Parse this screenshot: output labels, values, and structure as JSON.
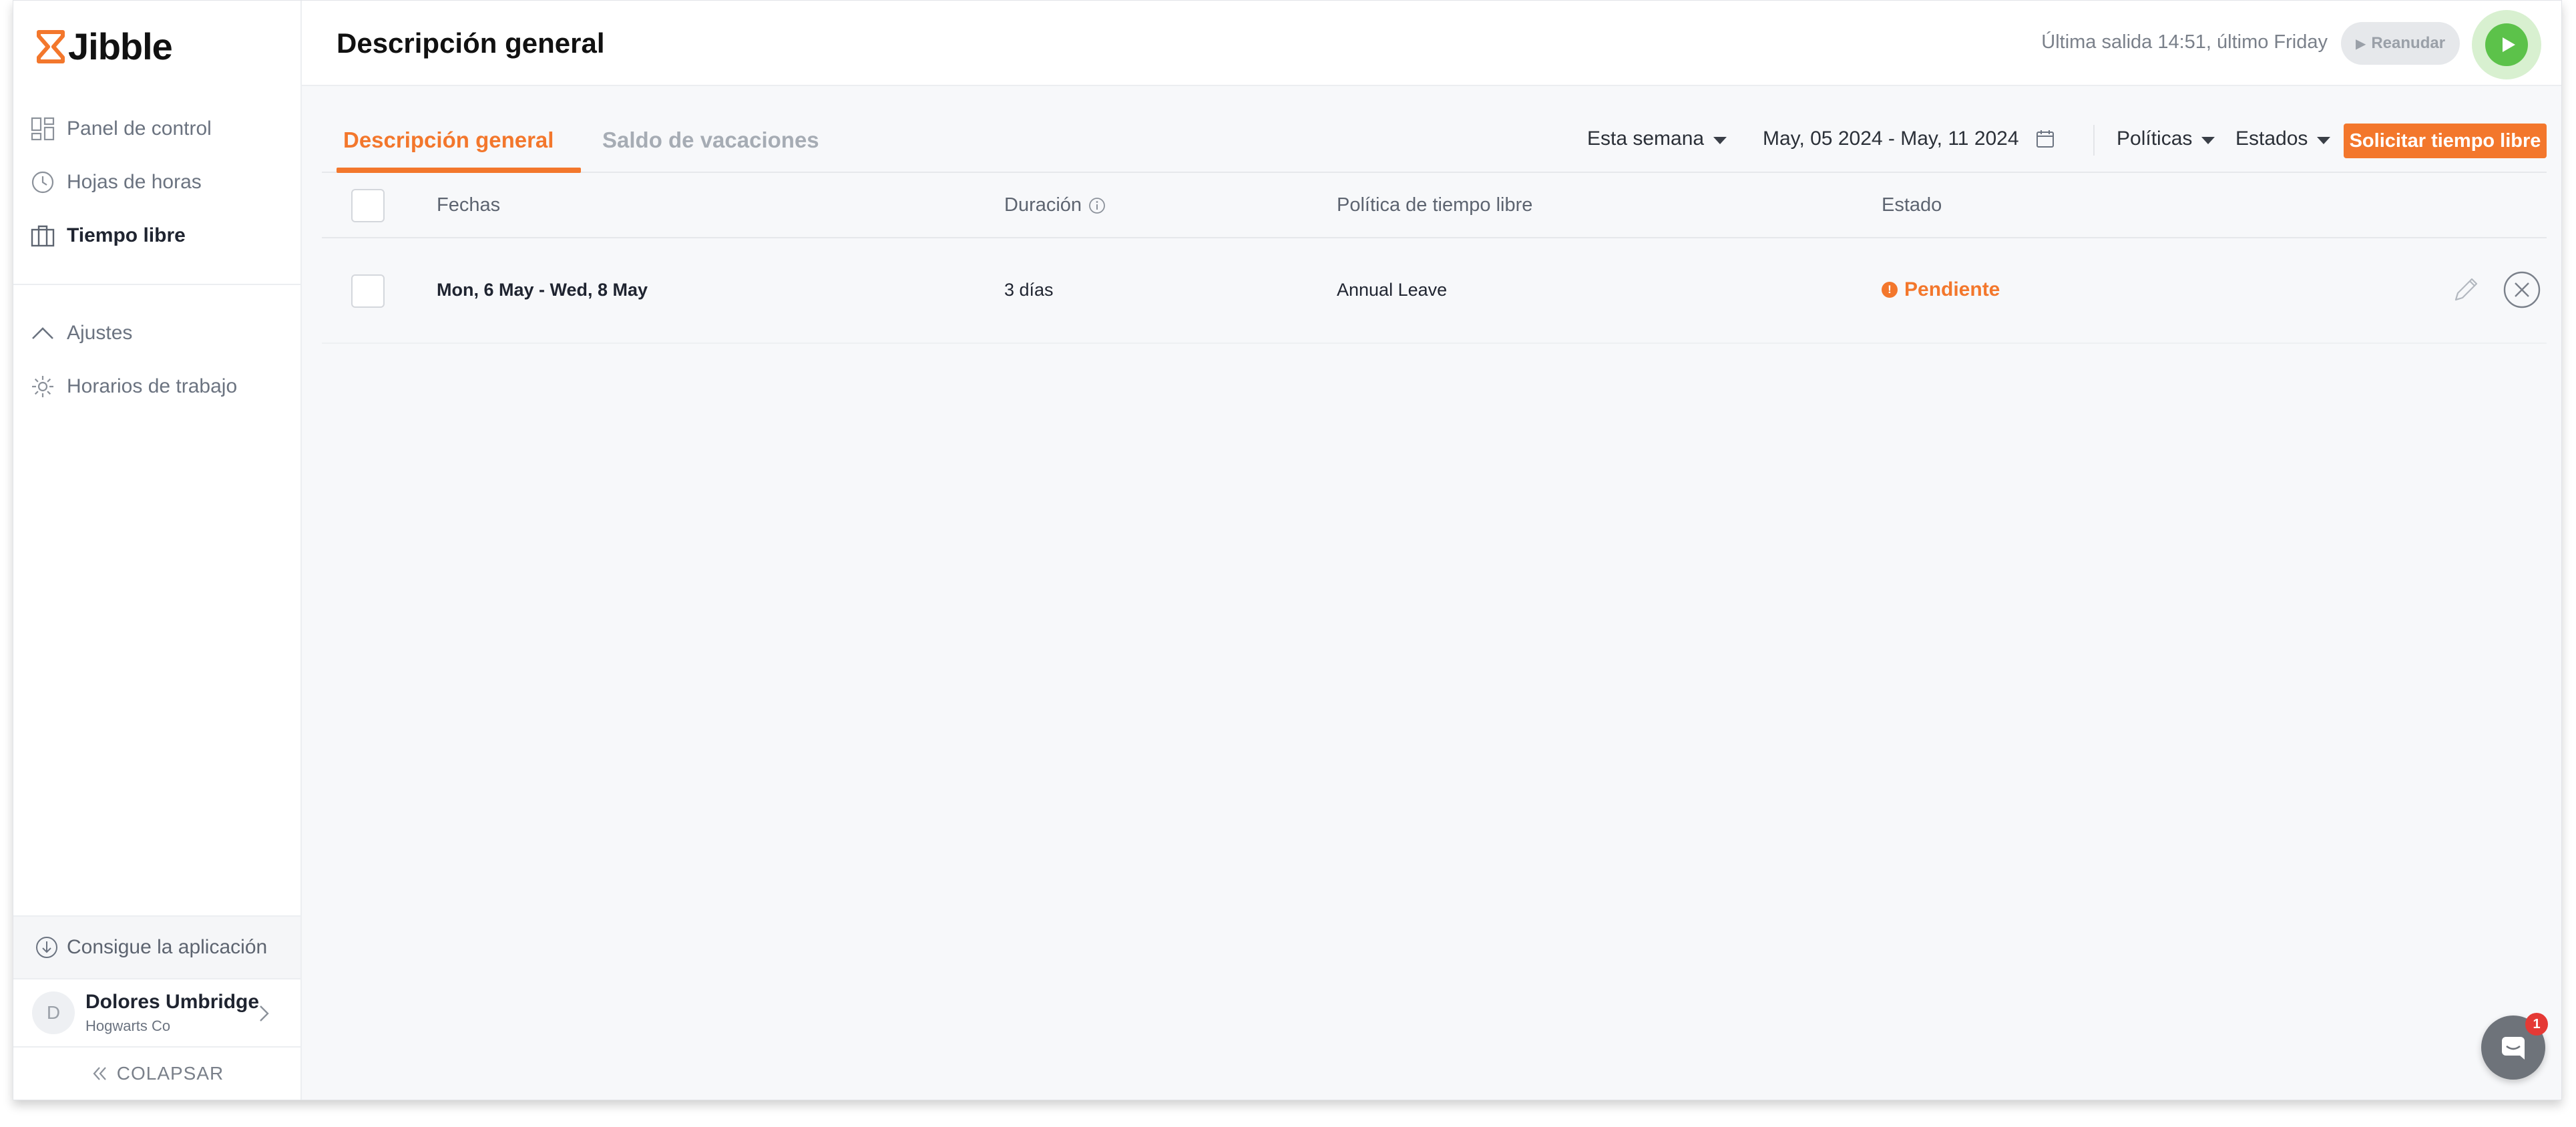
{
  "app": {
    "name": "Jibble"
  },
  "colors": {
    "accent": "#f3772c",
    "play": "#5cc24a",
    "sidebar_bg": "#ffffff",
    "content_bg": "#f7f8fa"
  },
  "sidebar": {
    "items": [
      {
        "label": "Panel de control",
        "icon": "dashboard-icon",
        "active": false
      },
      {
        "label": "Hojas de horas",
        "icon": "clock-icon",
        "active": false
      },
      {
        "label": "Tiempo libre",
        "icon": "briefcase-icon",
        "active": true
      },
      {
        "label": "Ajustes",
        "icon": "chevron-up-icon",
        "active": false
      },
      {
        "label": "Horarios de trabajo",
        "icon": "gear-icon",
        "active": false
      }
    ],
    "get_app": "Consigue la aplicación",
    "user": {
      "initial": "D",
      "name": "Dolores Umbridge",
      "org": "Hogwarts Co"
    },
    "collapse": "COLAPSAR"
  },
  "header": {
    "title": "Descripción general",
    "last_out": "Última salida 14:51, último Friday",
    "resume": "Reanudar"
  },
  "tabs": [
    {
      "label": "Descripción general",
      "active": true
    },
    {
      "label": "Saldo de vacaciones",
      "active": false
    }
  ],
  "filters": {
    "period": "Esta semana",
    "date_range": "May, 05 2024 - May, 11 2024",
    "policies": "Políticas",
    "states": "Estados",
    "request_button": "Solicitar tiempo libre"
  },
  "table": {
    "columns": [
      "Fechas",
      "Duración",
      "Política de tiempo libre",
      "Estado"
    ],
    "rows": [
      {
        "dates": "Mon, 6 May - Wed, 8 May",
        "duration": "3 días",
        "policy": "Annual Leave",
        "status": "Pendiente",
        "status_icon": "!"
      }
    ]
  },
  "chat": {
    "badge": "1"
  }
}
